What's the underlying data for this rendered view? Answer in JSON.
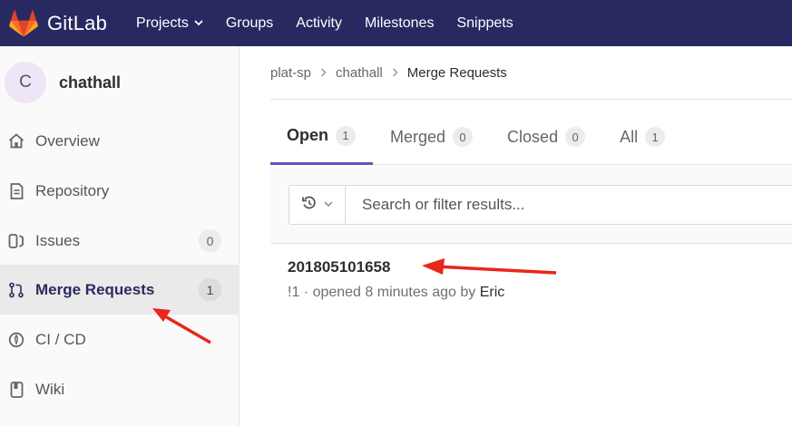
{
  "navbar": {
    "brand": "GitLab",
    "items": [
      {
        "label": "Projects",
        "has_dropdown": true
      },
      {
        "label": "Groups"
      },
      {
        "label": "Activity"
      },
      {
        "label": "Milestones"
      },
      {
        "label": "Snippets"
      }
    ],
    "background": "#292961"
  },
  "sidebar": {
    "project_initial": "C",
    "project_name": "chathall",
    "items": [
      {
        "label": "Overview",
        "icon": "home-icon"
      },
      {
        "label": "Repository",
        "icon": "document-icon"
      },
      {
        "label": "Issues",
        "icon": "issues-icon",
        "count": "0"
      },
      {
        "label": "Merge Requests",
        "icon": "merge-request-icon",
        "count": "1",
        "active": true
      },
      {
        "label": "CI / CD",
        "icon": "rocket-icon"
      },
      {
        "label": "Wiki",
        "icon": "book-icon"
      }
    ]
  },
  "breadcrumb": {
    "group": "plat-sp",
    "project": "chathall",
    "current": "Merge Requests"
  },
  "tabs": [
    {
      "label": "Open",
      "count": "1",
      "active": true
    },
    {
      "label": "Merged",
      "count": "0"
    },
    {
      "label": "Closed",
      "count": "0"
    },
    {
      "label": "All",
      "count": "1"
    }
  ],
  "filter": {
    "placeholder": "Search or filter results..."
  },
  "merge_request": {
    "title": "201805101658",
    "meta_prefix": "!1 · opened 8 minutes ago by ",
    "author": "Eric"
  },
  "accent_color": "#6b4fbb",
  "annotation_color": "#e8261b"
}
